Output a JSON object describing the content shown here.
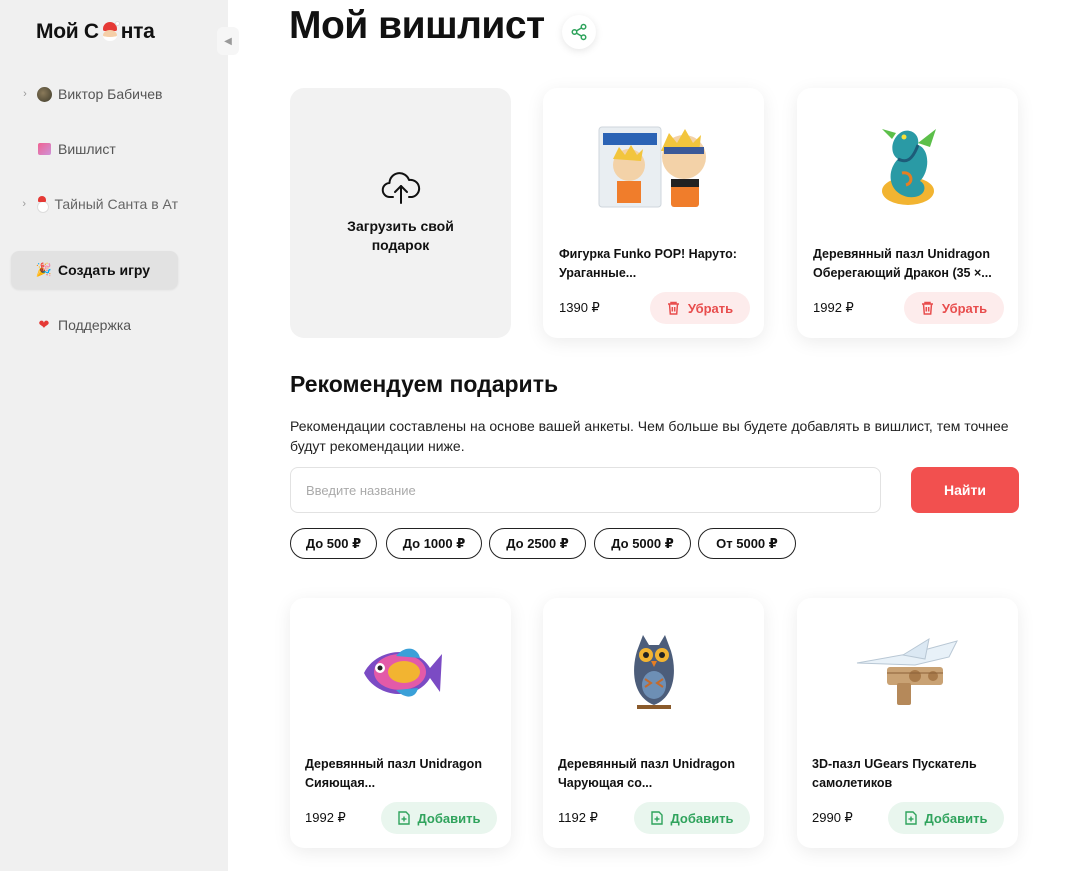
{
  "sidebar": {
    "logo_left": "Мой С",
    "logo_right": "нта",
    "items": [
      {
        "label": "Виктор Бабичев",
        "icon": "avatar-icon",
        "expandable": true
      },
      {
        "label": "Вишлист",
        "icon": "gift-bag-icon",
        "expandable": false
      },
      {
        "label": "Тайный Санта в Ат",
        "icon": "snowman-icon",
        "expandable": true
      },
      {
        "label": "Создать игру",
        "icon": "party-popper-icon",
        "expandable": false,
        "active": true
      },
      {
        "label": "Поддержка",
        "icon": "heart-icon",
        "expandable": false
      }
    ],
    "collapse_glyph": "◀"
  },
  "main": {
    "title": "Мой вишлист",
    "upload_label": "Загрузить свой подарок",
    "wishlist": [
      {
        "name": "Фигурка Funko POP! Наруто: Ураганные...",
        "price": "1390 ₽",
        "action": "Убрать",
        "image": "funko-naruto"
      },
      {
        "name": "Деревянный пазл Unidragon Оберегающий Дракон (35 ×...",
        "price": "1992 ₽",
        "action": "Убрать",
        "image": "dragon-puzzle"
      }
    ],
    "recommend": {
      "title": "Рекомендуем подарить",
      "description": "Рекомендации составлены на основе вашей анкеты. Чем больше вы будете добавлять в вишлист, тем точнее будут рекомендации ниже.",
      "search_placeholder": "Введите название",
      "search_button": "Найти",
      "filters": [
        "До 500 ₽",
        "До 1000 ₽",
        "До 2500 ₽",
        "До 5000 ₽",
        "От 5000 ₽"
      ],
      "items": [
        {
          "name": "Деревянный пазл Unidragon Сияющая...",
          "price": "1992 ₽",
          "action": "Добавить",
          "image": "fish-puzzle"
        },
        {
          "name": "Деревянный пазл Unidragon Чарующая со...",
          "price": "1192 ₽",
          "action": "Добавить",
          "image": "owl-puzzle"
        },
        {
          "name": "3D-пазл UGears Пускатель самолетиков",
          "price": "2990 ₽",
          "action": "Добавить",
          "image": "plane-launcher"
        }
      ]
    }
  },
  "colors": {
    "accent": "#f2504f",
    "remove": "#e84d4d",
    "add": "#2fa35c",
    "sidebar_bg": "#f0f0f0"
  }
}
